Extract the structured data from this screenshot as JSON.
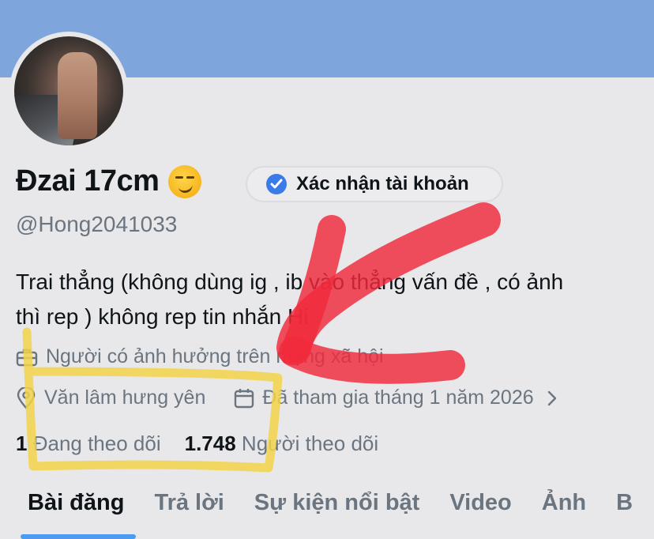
{
  "profile": {
    "name": "Đzai 17cm",
    "emoji": "😏",
    "verify_label": "Xác nhận tài khoản",
    "handle": "@Hong2041033",
    "bio_line1": "Trai thẳng (không dùng ig , ib vào thẳng vấn đề , có ảnh",
    "bio_line2": "thì rep ) không rep tin nhắn Hi",
    "category": "Người có ảnh hưởng trên mạng xã hội",
    "location": "Văn lâm hưng yên",
    "joined": "Đã tham gia tháng 1 năm 2026",
    "following_count": "1",
    "following_label": "Đang theo dõi",
    "followers_count": "1.748",
    "followers_label": "Người theo dõi"
  },
  "tabs": [
    "Bài đăng",
    "Trả lời",
    "Sự kiện nổi bật",
    "Video",
    "Ảnh",
    "B"
  ],
  "colors": {
    "banner": "#7fa6dc",
    "accent": "#4b9cf0",
    "annotation_red": "#f02a3c",
    "annotation_yellow": "#f2d44a"
  },
  "icons": [
    "verified-badge-icon",
    "briefcase-icon",
    "location-pin-icon",
    "calendar-icon",
    "chevron-right-icon"
  ]
}
